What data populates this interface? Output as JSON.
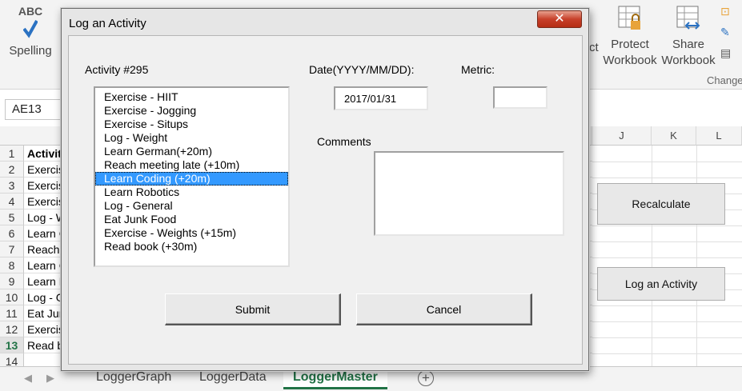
{
  "ribbon": {
    "spelling": {
      "top": "ABC",
      "label": "Spelling"
    },
    "protect_workbook": {
      "line1": "Protect",
      "line2": "Workbook"
    },
    "share_workbook": {
      "line1": "Share",
      "line2": "Workbook"
    },
    "partial_text": "ct",
    "group_label": "Change"
  },
  "formula": {
    "name_box": "AE13"
  },
  "grid": {
    "columns": [
      "J",
      "K",
      "L"
    ],
    "rows": [
      {
        "num": "1",
        "text": "Activit"
      },
      {
        "num": "2",
        "text": "Exercis"
      },
      {
        "num": "3",
        "text": "Exercis"
      },
      {
        "num": "4",
        "text": "Exercis"
      },
      {
        "num": "5",
        "text": "Log - W"
      },
      {
        "num": "6",
        "text": "Learn G"
      },
      {
        "num": "7",
        "text": "Reach"
      },
      {
        "num": "8",
        "text": "Learn C"
      },
      {
        "num": "9",
        "text": "Learn R"
      },
      {
        "num": "10",
        "text": "Log - G"
      },
      {
        "num": "11",
        "text": "Eat Jun"
      },
      {
        "num": "12",
        "text": "Exercis"
      },
      {
        "num": "13",
        "text": "Read b"
      },
      {
        "num": "14",
        "text": ""
      }
    ],
    "recalculate_button": "Recalculate",
    "log_activity_button": "Log an Activity"
  },
  "tabs": {
    "items": [
      {
        "label": "LoggerGraph",
        "active": false
      },
      {
        "label": "LoggerData",
        "active": false
      },
      {
        "label": "LoggerMaster",
        "active": true
      }
    ],
    "add": "+"
  },
  "dialog": {
    "title": "Log an Activity",
    "close": "✕",
    "activity_label": "Activity #295",
    "date_label": "Date(YYYY/MM/DD):",
    "date_value": "2017/01/31",
    "metric_label": "Metric:",
    "metric_value": "",
    "comments_label": "Comments",
    "comments_value": "",
    "activities": [
      "Exercise - HIIT",
      "Exercise - Jogging",
      "Exercise - Situps",
      "Log - Weight",
      "Learn German(+20m)",
      "Reach meeting late (+10m)",
      "Learn Coding (+20m)",
      "Learn Robotics",
      "Log - General",
      "Eat Junk Food",
      "Exercise - Weights (+15m)",
      "Read book (+30m)"
    ],
    "selected_index": 6,
    "submit": "Submit",
    "cancel": "Cancel"
  },
  "colors": {
    "selection": "#3399ff",
    "excel_green": "#217346",
    "close_red": "#c7402a"
  }
}
